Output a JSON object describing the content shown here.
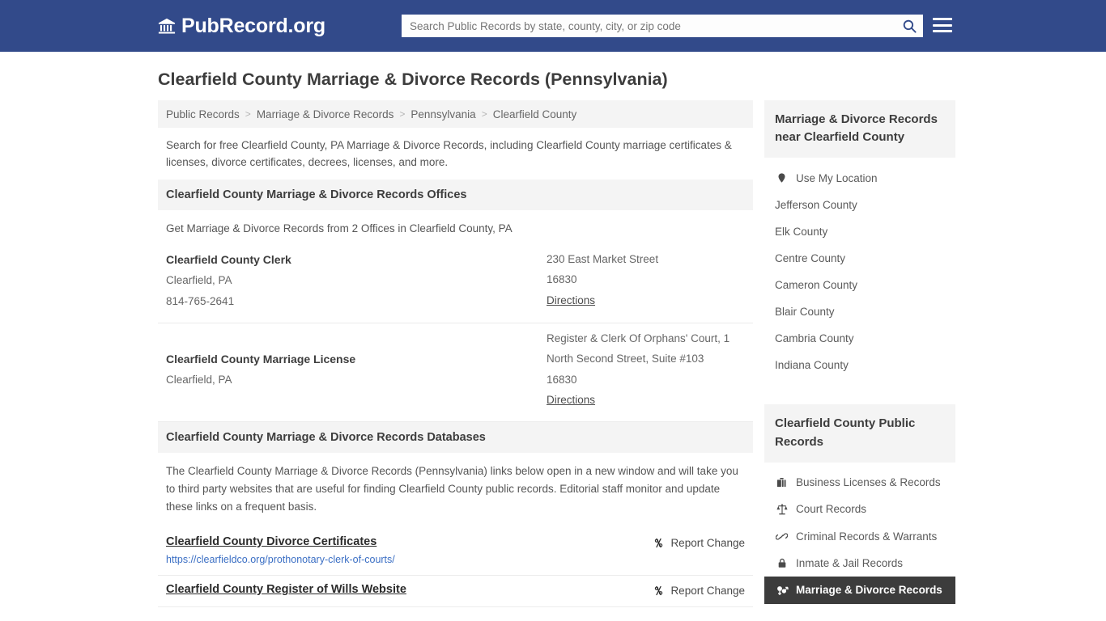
{
  "header": {
    "logo_icon": "bank-building-icon",
    "logo_text": "PubRecord.org",
    "search_placeholder": "Search Public Records by state, county, city, or zip code",
    "search_value": "",
    "search_icon": "search-icon",
    "menu_icon": "hamburger-menu-icon"
  },
  "page": {
    "title": "Clearfield County Marriage & Divorce Records (Pennsylvania)"
  },
  "breadcrumb": {
    "separator": ">",
    "items": [
      {
        "label": "Public Records"
      },
      {
        "label": "Marriage & Divorce Records"
      },
      {
        "label": "Pennsylvania"
      },
      {
        "label": "Clearfield County"
      }
    ]
  },
  "intro": "Search for free Clearfield County, PA Marriage & Divorce Records, including Clearfield County marriage certificates & licenses, divorce certificates, decrees, licenses, and more.",
  "offices_section": {
    "heading": "Clearfield County Marriage & Divorce Records Offices",
    "subheading": "Get Marriage & Divorce Records from 2 Offices in Clearfield County, PA",
    "directions_label": "Directions",
    "offices": [
      {
        "name": "Clearfield County Clerk",
        "city_state": "Clearfield, PA",
        "phone": "814-765-2641",
        "address": "230 East Market Street",
        "zip": "16830"
      },
      {
        "name": "Clearfield County Marriage License",
        "city_state": "Clearfield, PA",
        "phone": "",
        "address": "Register & Clerk Of Orphans' Court, 1 North Second Street, Suite #103",
        "zip": "16830"
      }
    ]
  },
  "databases_section": {
    "heading": "Clearfield County Marriage & Divorce Records Databases",
    "note": "The Clearfield County Marriage & Divorce Records (Pennsylvania) links below open in a new window and will take you to third party websites that are useful for finding Clearfield County public records. Editorial staff monitor and update these links on a frequent basis.",
    "report_change_label": "Report Change",
    "report_change_icon": "broken-link-icon",
    "links": [
      {
        "title": "Clearfield County Divorce Certificates",
        "url": "https://clearfieldco.org/prothonotary-clerk-of-courts/"
      },
      {
        "title": "Clearfield County Register of Wills Website",
        "url": ""
      }
    ]
  },
  "sidebar": {
    "nearby_panel": {
      "heading": "Marriage & Divorce Records near Clearfield County",
      "use_my_location": {
        "label": "Use My Location",
        "icon": "map-pin-icon"
      },
      "counties": [
        {
          "label": "Jefferson County"
        },
        {
          "label": "Elk County"
        },
        {
          "label": "Centre County"
        },
        {
          "label": "Cameron County"
        },
        {
          "label": "Blair County"
        },
        {
          "label": "Cambria County"
        },
        {
          "label": "Indiana County"
        }
      ]
    },
    "records_panel": {
      "heading": "Clearfield County Public Records",
      "items": [
        {
          "label": "Business Licenses & Records",
          "icon": "briefcase-icon",
          "active": false
        },
        {
          "label": "Court Records",
          "icon": "scales-of-justice-icon",
          "active": false
        },
        {
          "label": "Criminal Records & Warrants",
          "icon": "handcuffs-icon",
          "active": false
        },
        {
          "label": "Inmate & Jail Records",
          "icon": "lock-icon",
          "active": false
        },
        {
          "label": "Marriage & Divorce Records",
          "icon": "venus-mars-icon",
          "active": true
        }
      ]
    }
  },
  "colors": {
    "header_blue": "#324a8a",
    "panel_gray": "#f4f4f4",
    "active_dark": "#3c3c3c",
    "link_blue": "#3b6fc4"
  }
}
